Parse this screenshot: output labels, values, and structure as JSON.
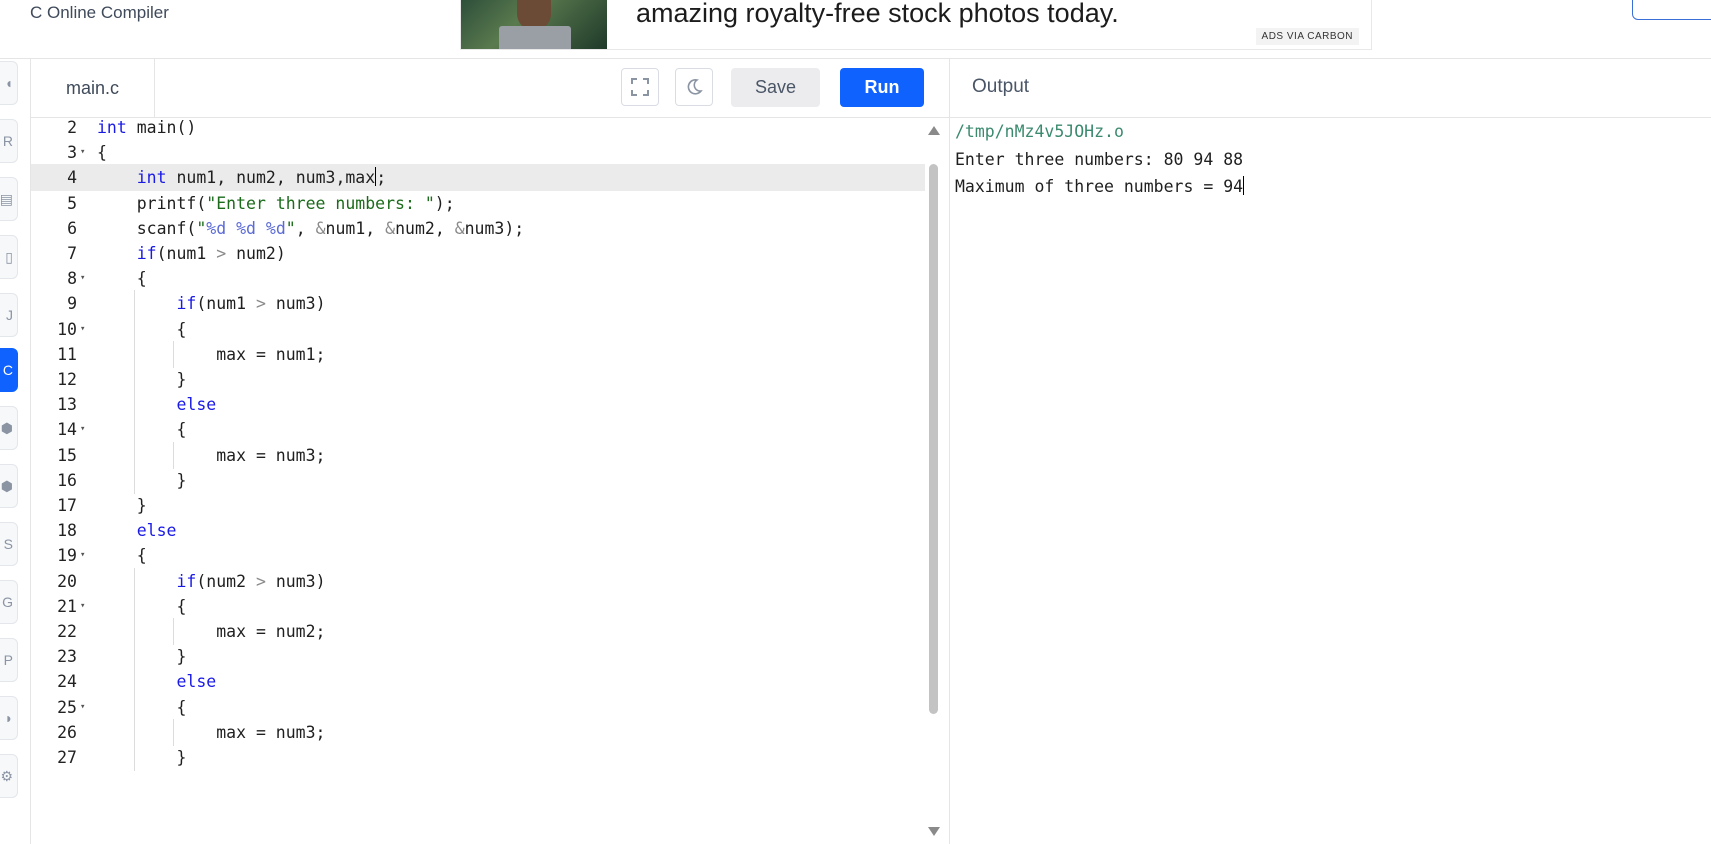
{
  "header": {
    "brand": "C Online Compiler",
    "ad_text": "amazing royalty-free stock photos today.",
    "ad_via": "ADS VIA CARBON"
  },
  "sidebar": {
    "items": [
      {
        "icon": "python-icon",
        "glyph": "◖",
        "active": false
      },
      {
        "icon": "r-icon",
        "glyph": "R",
        "active": false
      },
      {
        "icon": "sql-icon",
        "glyph": "▤",
        "active": false
      },
      {
        "icon": "html-icon",
        "glyph": "▯",
        "active": false
      },
      {
        "icon": "java-icon",
        "glyph": "J",
        "active": false
      },
      {
        "icon": "c-icon",
        "glyph": "C",
        "active": true
      },
      {
        "icon": "cpp-icon",
        "glyph": "⬢",
        "active": false
      },
      {
        "icon": "csharp-icon",
        "glyph": "⬢",
        "active": false
      },
      {
        "icon": "js-icon",
        "glyph": "S",
        "active": false
      },
      {
        "icon": "go-icon",
        "glyph": "G",
        "active": false
      },
      {
        "icon": "php-icon",
        "glyph": "P",
        "active": false
      },
      {
        "icon": "swift-icon",
        "glyph": "◗",
        "active": false
      },
      {
        "icon": "rust-icon",
        "glyph": "⚙",
        "active": false
      }
    ]
  },
  "editor": {
    "file_tab": "main.c",
    "save_label": "Save",
    "run_label": "Run",
    "lines": [
      {
        "num": "2",
        "code": "int main()"
      },
      {
        "num": "3",
        "code": "{"
      },
      {
        "num": "4",
        "code": "    int num1, num2, num3,max;"
      },
      {
        "num": "5",
        "code": "    printf(\"Enter three numbers: \");"
      },
      {
        "num": "6",
        "code": "    scanf(\"%d %d %d\", &num1, &num2, &num3);"
      },
      {
        "num": "7",
        "code": "    if(num1 > num2)"
      },
      {
        "num": "8",
        "code": "    {"
      },
      {
        "num": "9",
        "code": "        if(num1 > num3)"
      },
      {
        "num": "10",
        "code": "        {"
      },
      {
        "num": "11",
        "code": "            max = num1;"
      },
      {
        "num": "12",
        "code": "        }"
      },
      {
        "num": "13",
        "code": "        else"
      },
      {
        "num": "14",
        "code": "        {"
      },
      {
        "num": "15",
        "code": "            max = num3;"
      },
      {
        "num": "16",
        "code": "        }"
      },
      {
        "num": "17",
        "code": "    }"
      },
      {
        "num": "18",
        "code": "    else"
      },
      {
        "num": "19",
        "code": "    {"
      },
      {
        "num": "20",
        "code": "        if(num2 > num3)"
      },
      {
        "num": "21",
        "code": "        {"
      },
      {
        "num": "22",
        "code": "            max = num2;"
      },
      {
        "num": "23",
        "code": "        }"
      },
      {
        "num": "24",
        "code": "        else"
      },
      {
        "num": "25",
        "code": "        {"
      },
      {
        "num": "26",
        "code": "            max = num3;"
      },
      {
        "num": "27",
        "code": "        }"
      }
    ]
  },
  "output": {
    "title": "Output",
    "path": "/tmp/nMz4v5JOHz.o",
    "line1": "Enter three numbers: 80 94 88",
    "line2": "Maximum of three numbers = 94"
  }
}
